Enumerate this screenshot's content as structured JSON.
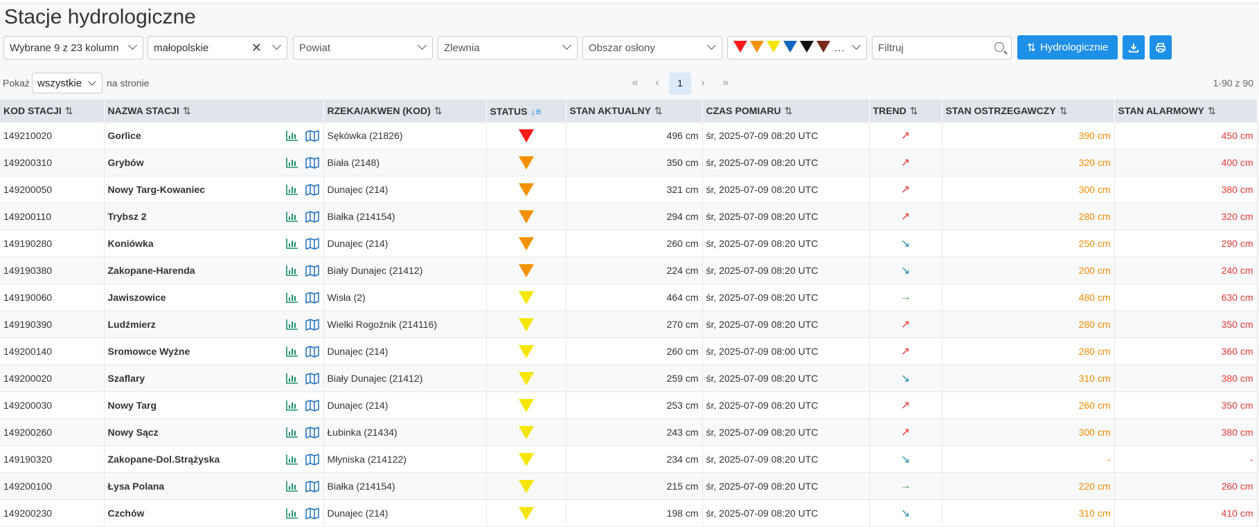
{
  "page": {
    "title": "Stacje hydrologiczne"
  },
  "toolbar": {
    "columns_select": "Wybrane 9 z 23 kolumn",
    "region_select": "małopolskie",
    "powiat_placeholder": "Powiat",
    "zlewnia_placeholder": "Zlewnia",
    "obszar_placeholder": "Obszar osłony",
    "status_colors": [
      "#ff1a1a",
      "#f39200",
      "#f5e600",
      "#1565c0",
      "#111111",
      "#7a2a1a"
    ],
    "status_more": "...",
    "filter_placeholder": "Filtruj",
    "hydro_button": "Hydrologicznie"
  },
  "pager": {
    "show_label": "Pokaż",
    "per_page": "wszystkie",
    "per_page_suffix": "na stronie",
    "current_page": "1",
    "first": "«",
    "prev": "‹",
    "next": "›",
    "last": "»",
    "range": "1-90 z 90"
  },
  "table": {
    "headers": {
      "code": "KOD STACJI",
      "name": "NAZWA STACJI",
      "river": "RZEKA/AKWEN (KOD)",
      "status": "STATUS",
      "level": "STAN AKTUALNY",
      "time": "CZAS POMIARU",
      "trend": "TREND",
      "warn": "STAN OSTRZEGAWCZY",
      "alarm": "STAN ALARMOWY"
    },
    "sort_icon": "⇅",
    "sort_active_icon": "↓≡",
    "status_colors": {
      "red": "#ff1a1a",
      "orange": "#f39200",
      "yellow": "#f5e600"
    },
    "trend_colors": {
      "up": "#e53935",
      "down": "#1a8fb0",
      "flat": "#43a047"
    },
    "rows": [
      {
        "code": "149210020",
        "name": "Gorlice",
        "river": "Sękówka (21826)",
        "status": "red",
        "level": "496 cm",
        "time": "śr, 2025-07-09 08:20 UTC",
        "trend": "up",
        "trend_icon": "↗",
        "warn": "390 cm",
        "alarm": "450 cm"
      },
      {
        "code": "149200310",
        "name": "Grybów",
        "river": "Biała (2148)",
        "status": "orange",
        "level": "350 cm",
        "time": "śr, 2025-07-09 08:20 UTC",
        "trend": "up",
        "trend_icon": "↗",
        "warn": "320 cm",
        "alarm": "400 cm"
      },
      {
        "code": "149200050",
        "name": "Nowy Targ-Kowaniec",
        "river": "Dunajec (214)",
        "status": "orange",
        "level": "321 cm",
        "time": "śr, 2025-07-09 08:20 UTC",
        "trend": "up",
        "trend_icon": "↗",
        "warn": "300 cm",
        "alarm": "380 cm"
      },
      {
        "code": "149200110",
        "name": "Trybsz 2",
        "river": "Białka (214154)",
        "status": "orange",
        "level": "294 cm",
        "time": "śr, 2025-07-09 08:20 UTC",
        "trend": "up",
        "trend_icon": "↗",
        "warn": "280 cm",
        "alarm": "320 cm"
      },
      {
        "code": "149190280",
        "name": "Koniówka",
        "river": "Dunajec (214)",
        "status": "orange",
        "level": "260 cm",
        "time": "śr, 2025-07-09 08:20 UTC",
        "trend": "down",
        "trend_icon": "↘",
        "warn": "250 cm",
        "alarm": "290 cm"
      },
      {
        "code": "149190380",
        "name": "Zakopane-Harenda",
        "river": "Biały Dunajec (21412)",
        "status": "orange",
        "level": "224 cm",
        "time": "śr, 2025-07-09 08:20 UTC",
        "trend": "down",
        "trend_icon": "↘",
        "warn": "200 cm",
        "alarm": "240 cm"
      },
      {
        "code": "149190060",
        "name": "Jawiszowice",
        "river": "Wisła (2)",
        "status": "yellow",
        "level": "464 cm",
        "time": "śr, 2025-07-09 08:20 UTC",
        "trend": "flat",
        "trend_icon": "→",
        "warn": "480 cm",
        "alarm": "630 cm"
      },
      {
        "code": "149190390",
        "name": "Ludźmierz",
        "river": "Wielki Rogoźnik (214116)",
        "status": "yellow",
        "level": "270 cm",
        "time": "śr, 2025-07-09 08:20 UTC",
        "trend": "up",
        "trend_icon": "↗",
        "warn": "280 cm",
        "alarm": "350 cm"
      },
      {
        "code": "149200140",
        "name": "Sromowce Wyżne",
        "river": "Dunajec (214)",
        "status": "yellow",
        "level": "260 cm",
        "time": "śr, 2025-07-09 08:00 UTC",
        "trend": "up",
        "trend_icon": "↗",
        "warn": "280 cm",
        "alarm": "360 cm"
      },
      {
        "code": "149200020",
        "name": "Szaflary",
        "river": "Biały Dunajec (21412)",
        "status": "yellow",
        "level": "259 cm",
        "time": "śr, 2025-07-09 08:20 UTC",
        "trend": "down",
        "trend_icon": "↘",
        "warn": "310 cm",
        "alarm": "380 cm"
      },
      {
        "code": "149200030",
        "name": "Nowy Targ",
        "river": "Dunajec (214)",
        "status": "yellow",
        "level": "253 cm",
        "time": "śr, 2025-07-09 08:20 UTC",
        "trend": "up",
        "trend_icon": "↗",
        "warn": "260 cm",
        "alarm": "350 cm"
      },
      {
        "code": "149200260",
        "name": "Nowy Sącz",
        "river": "Łubinka (21434)",
        "status": "yellow",
        "level": "243 cm",
        "time": "śr, 2025-07-09 08:20 UTC",
        "trend": "up",
        "trend_icon": "↗",
        "warn": "300 cm",
        "alarm": "380 cm"
      },
      {
        "code": "149190320",
        "name": "Zakopane-Dol.Strążyska",
        "river": "Młyniska (214122)",
        "status": "yellow",
        "level": "234 cm",
        "time": "śr, 2025-07-09 08:20 UTC",
        "trend": "down",
        "trend_icon": "↘",
        "warn": "-",
        "alarm": "-"
      },
      {
        "code": "149200100",
        "name": "Łysa Polana",
        "river": "Białka (214154)",
        "status": "yellow",
        "level": "215 cm",
        "time": "śr, 2025-07-09 08:20 UTC",
        "trend": "flat",
        "trend_icon": "→",
        "warn": "220 cm",
        "alarm": "260 cm"
      },
      {
        "code": "149200230",
        "name": "Czchów",
        "river": "Dunajec (214)",
        "status": "yellow",
        "level": "198 cm",
        "time": "śr, 2025-07-09 08:20 UTC",
        "trend": "down",
        "trend_icon": "↘",
        "warn": "310 cm",
        "alarm": "410 cm"
      }
    ]
  }
}
